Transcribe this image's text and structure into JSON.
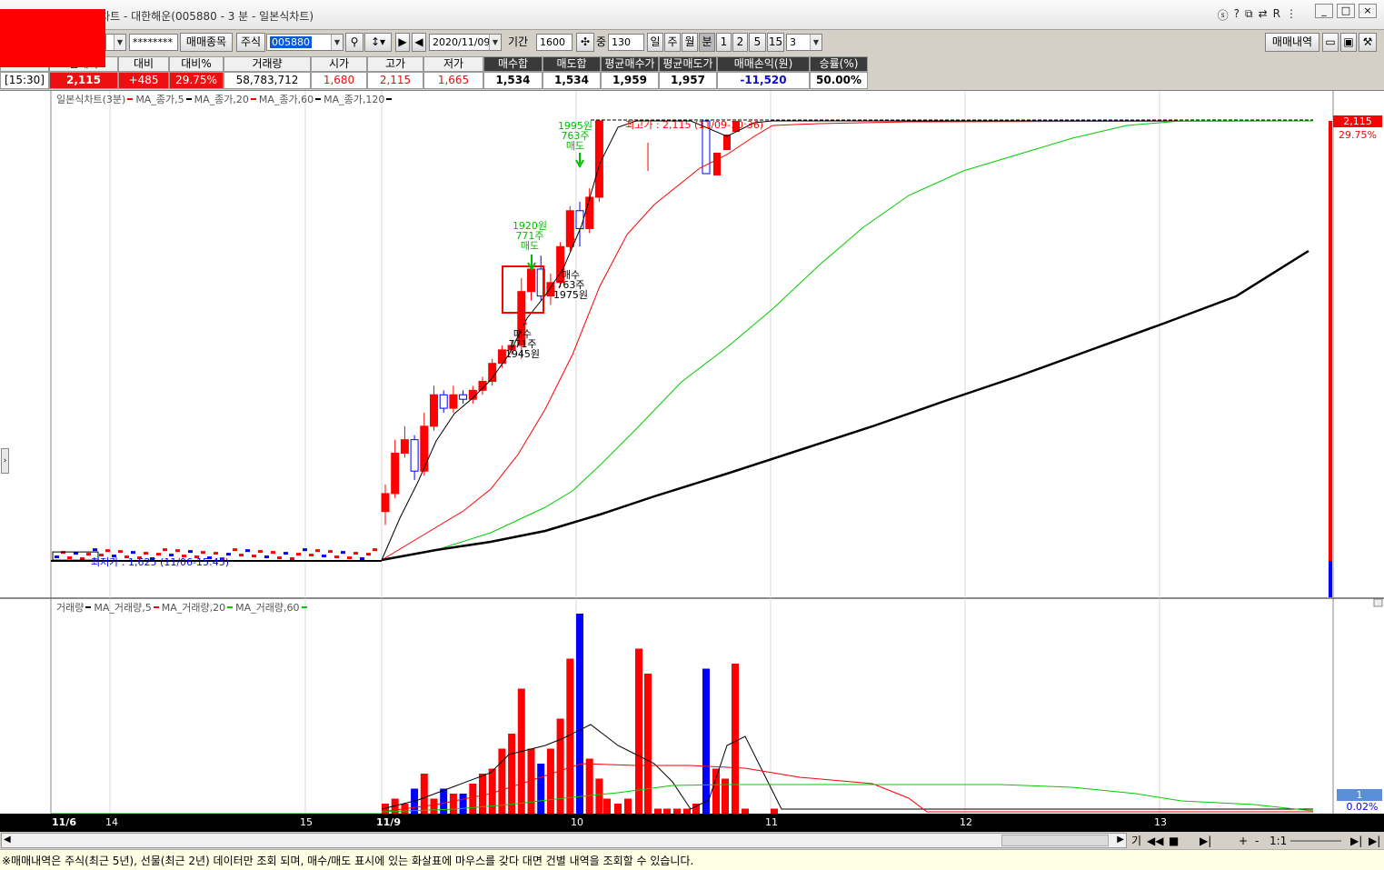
{
  "window": {
    "title": "[9450]매매분석차트 - 대한해운(005880 - 3 분 - 일본식차트)",
    "icons": [
      "help-icon",
      "question-icon",
      "window-icon",
      "link-icon",
      "r-icon",
      "settings-icon"
    ],
    "buttons": [
      "_",
      "□",
      "×"
    ]
  },
  "toolbar": {
    "account_mask": "********",
    "trade_items_label": "매매종목",
    "market_label": "주식",
    "code": "005880",
    "date": "2020/11/09",
    "period_label": "기간",
    "period_value": "1600",
    "middle_label": "중",
    "middle_value": "130",
    "period_units": [
      "일",
      "주",
      "월",
      "분"
    ],
    "minute_options": [
      "1",
      "2",
      "5",
      "15"
    ],
    "minute_value": "3",
    "trade_history_label": "매매내역"
  },
  "info": {
    "headers": [
      "현재가",
      "대비",
      "대비%",
      "거래량",
      "시가",
      "고가",
      "저가",
      "매수합",
      "매도합",
      "평균매수가",
      "평균매도가",
      "매매손익(원)",
      "승률(%)"
    ],
    "time": "[15:30]",
    "values": [
      "2,115",
      "+485",
      "29.75%",
      "58,783,712",
      "1,680",
      "2,115",
      "1,665",
      "1,534",
      "1,534",
      "1,959",
      "1,957",
      "-11,520",
      "50.00%"
    ]
  },
  "price_legend": {
    "name": "일본식차트(3분)",
    "items": [
      {
        "label": "MA_종가,5",
        "color": "#ff0000"
      },
      {
        "label": "MA_종가,20",
        "color": "#000000"
      },
      {
        "label": "MA_종가,60",
        "color": "#ff0000"
      },
      {
        "label": "MA_종가,120",
        "color": "#000000"
      }
    ]
  },
  "volume_legend": {
    "name": "거래량",
    "items": [
      {
        "label": "MA_거래량,5",
        "color": "#000000"
      },
      {
        "label": "MA_거래량,20",
        "color": "#ff0000"
      },
      {
        "label": "MA_거래량,60",
        "color": "#00cc00"
      }
    ]
  },
  "annotations": {
    "high": "최고가 : 2,115 (11/09-10:36)",
    "low": "최저가 : 1,625 (11/06-15:45)",
    "buy1": [
      "매수",
      "771주",
      "1945원"
    ],
    "sell1": [
      "1920원",
      "771주",
      "매도"
    ],
    "buy2": [
      "매수",
      "763주",
      "1975원"
    ],
    "sell2": [
      "1995원",
      "763주",
      "매도"
    ]
  },
  "right_axis": {
    "price": "2,115",
    "pct": "29.75%",
    "vol_value": "1",
    "vol_pct": "0.02%"
  },
  "x_axis": [
    "11/6",
    "14",
    "15",
    "11/9",
    "10",
    "11",
    "12",
    "13"
  ],
  "bottom_controls": {
    "labels": [
      "기",
      "◀◀",
      "■",
      "▶|",
      "+",
      "-",
      "1:1"
    ]
  },
  "status": "※매매내역은 주식(최근 5년), 선물(최근 2년) 데이터만 조회 되며, 매수/매도 표시에 있는 화살표에 마우스를 갖다 대면 건별 내역을 조회할 수 있습니다.",
  "chart_data": {
    "type": "candlestick",
    "interval": "3분",
    "candles_11_9": [
      {
        "o": 1680,
        "c": 1700,
        "h": 1710,
        "l": 1665
      },
      {
        "o": 1700,
        "c": 1745,
        "h": 1760,
        "l": 1695
      },
      {
        "o": 1745,
        "c": 1760,
        "h": 1775,
        "l": 1740
      },
      {
        "o": 1760,
        "c": 1725,
        "h": 1765,
        "l": 1715
      },
      {
        "o": 1725,
        "c": 1775,
        "h": 1790,
        "l": 1720
      },
      {
        "o": 1775,
        "c": 1810,
        "h": 1820,
        "l": 1770
      },
      {
        "o": 1810,
        "c": 1795,
        "h": 1815,
        "l": 1790
      },
      {
        "o": 1795,
        "c": 1810,
        "h": 1820,
        "l": 1790
      },
      {
        "o": 1810,
        "c": 1805,
        "h": 1815,
        "l": 1800
      },
      {
        "o": 1805,
        "c": 1815,
        "h": 1820,
        "l": 1800
      },
      {
        "o": 1815,
        "c": 1825,
        "h": 1830,
        "l": 1810
      },
      {
        "o": 1825,
        "c": 1845,
        "h": 1850,
        "l": 1820
      },
      {
        "o": 1845,
        "c": 1860,
        "h": 1865,
        "l": 1840
      },
      {
        "o": 1860,
        "c": 1865,
        "h": 1870,
        "l": 1855
      },
      {
        "o": 1865,
        "c": 1925,
        "h": 1940,
        "l": 1850
      },
      {
        "o": 1925,
        "c": 1950,
        "h": 1960,
        "l": 1915
      },
      {
        "o": 1950,
        "c": 1920,
        "h": 1965,
        "l": 1915
      },
      {
        "o": 1920,
        "c": 1935,
        "h": 1945,
        "l": 1910
      },
      {
        "o": 1935,
        "c": 1975,
        "h": 1980,
        "l": 1930
      },
      {
        "o": 1975,
        "c": 2015,
        "h": 2020,
        "l": 1970
      },
      {
        "o": 2015,
        "c": 1995,
        "h": 2025,
        "l": 1975
      },
      {
        "o": 1995,
        "c": 2030,
        "h": 2040,
        "l": 1990
      },
      {
        "o": 2030,
        "c": 2115,
        "h": 2115,
        "l": 2025
      }
    ],
    "volumes_11_9": [
      2,
      3,
      2,
      5,
      8,
      3,
      5,
      4,
      4,
      6,
      8,
      9,
      13,
      16,
      25,
      13,
      10,
      13,
      19,
      31,
      40,
      11,
      7
    ]
  }
}
